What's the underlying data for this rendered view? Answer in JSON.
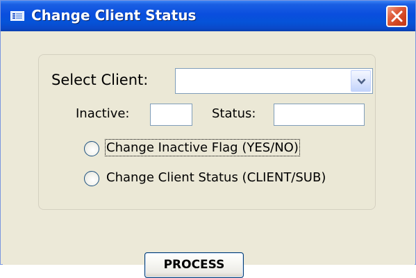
{
  "window": {
    "title": "Change Client Status",
    "icon": "form-icon",
    "close_icon": "close-icon"
  },
  "form": {
    "select_client_label": "Select Client:",
    "select_client_value": "",
    "inactive_label": "Inactive:",
    "inactive_value": "",
    "status_label": "Status:",
    "status_value": "",
    "options": [
      {
        "label": "Change Inactive Flag (YES/NO)",
        "selected": false,
        "focused": true
      },
      {
        "label": "Change Client Status (CLIENT/SUB)",
        "selected": false,
        "focused": false
      }
    ],
    "process_label": "PROCESS"
  },
  "colors": {
    "titlebar": "#0a4ede",
    "window_bg": "#ece9d8",
    "close_button": "#d0431f",
    "field_border": "#7f9db9"
  }
}
